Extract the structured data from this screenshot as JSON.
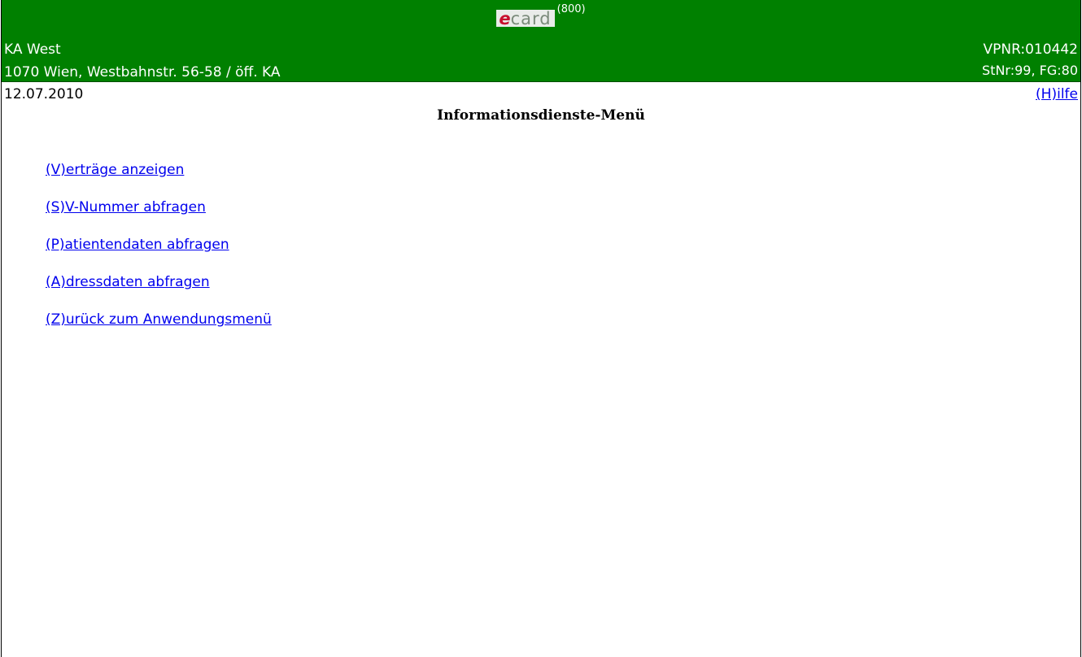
{
  "header": {
    "logo_prefix": "e",
    "logo_suffix": "card",
    "screen_code": "(800)",
    "org_name": "KA West",
    "org_address": "1070 Wien, Westbahnstr. 56-58 / öff. KA",
    "vpnr": "VPNR:010442",
    "stnr_fg": "StNr:99, FG:80"
  },
  "subbar": {
    "date": "12.07.2010",
    "help_link": "(H)ilfe"
  },
  "page_title": "Informationsdienste-Menü",
  "menu": {
    "items": [
      {
        "label": "(V)erträge anzeigen"
      },
      {
        "label": "(S)V-Nummer abfragen"
      },
      {
        "label": "(P)atientendaten abfragen"
      },
      {
        "label": "(A)dressdaten abfragen"
      },
      {
        "label": "(Z)urück zum Anwendungsmenü"
      }
    ]
  },
  "colors": {
    "header_bg": "#008000",
    "link": "#0000ee",
    "logo_e": "#c8102e"
  }
}
